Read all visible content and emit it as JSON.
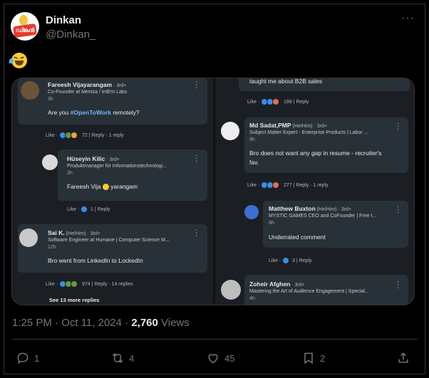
{
  "tweet": {
    "author_name": "Dinkan",
    "handle": "@Dinkan_",
    "more": "···",
    "timestamp": "1:25 PM · Oct 11, 2024 · ",
    "views_count": "2,760",
    "views_label": " Views",
    "replies": "1",
    "retweets": "4",
    "likes": "45",
    "bookmarks": "2",
    "avatar_text": "ഡിങ്കൻ"
  },
  "left": {
    "c1": {
      "name": "Fareesh Vijayarangam",
      "meta": " · 3rd+",
      "sub": "Co-Founder at Mentza / IntEm Labs",
      "time": "3h",
      "body_pre": "Are you ",
      "tag": "#OpenToWork",
      "body_post": " remotely?",
      "actions": {
        "like": "Like",
        "count": "72",
        "reply": "Reply",
        "replies": "1 reply"
      }
    },
    "c2": {
      "name": "Hüseyin Kilic",
      "meta": " · 3rd+",
      "sub": "Produktmanager für Informationstechnologi...",
      "time": "2h",
      "body_pre": "Fareesh Vija ",
      "body_post": " yarangam",
      "actions": {
        "like": "Like",
        "count": "1",
        "reply": "Reply"
      }
    },
    "c3": {
      "name": "Sai K.",
      "meta": " (He/Him) · 3rd+",
      "sub": "Software Engineer at Humane | Computer Science M...",
      "time": "12h",
      "body": "Bro went from LinkedIn to LockedIn",
      "actions": {
        "like": "Like",
        "count": "974",
        "reply": "Reply",
        "replies": "14 replies"
      }
    },
    "see_more": "See 13 more replies"
  },
  "right": {
    "top_body": "taught me about B2B sales",
    "top_actions": {
      "like": "Like",
      "count": "198",
      "reply": "Reply"
    },
    "c1": {
      "name": "Md Sadat,PMP",
      "meta": " (He/Him) · 3rd+",
      "sub": "Subject Matter Expert - Enterprise Products | Labor ...",
      "time": "9h",
      "body1": "Bro does not want any gap in resume - recruiter's",
      "body2": "fav.",
      "actions": {
        "like": "Like",
        "count": "277",
        "reply": "Reply",
        "replies": "1 reply"
      }
    },
    "c2": {
      "name": "Matthew Buxton",
      "meta": " (He/Him) · 3rd+",
      "sub": "MYSTIC GAMES CEO and CoFounder | Free t...",
      "time": "6h",
      "body": "Underrated comment",
      "actions": {
        "like": "Like",
        "count": "3",
        "reply": "Reply"
      }
    },
    "c3": {
      "name": "Zoheir Afghen",
      "meta": " · 3rd+",
      "sub": "Mastering the Art of Audience Engagement | Special...",
      "time": "4h"
    }
  },
  "colors": {
    "accent": "#71b7fb",
    "bg": "#000000",
    "muted": "#71767b"
  }
}
